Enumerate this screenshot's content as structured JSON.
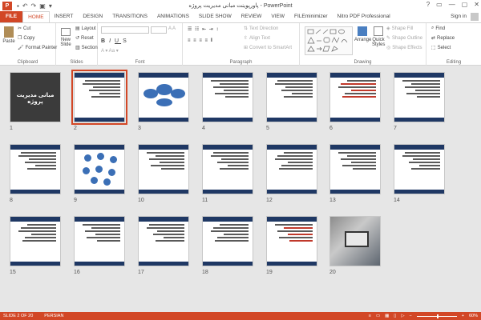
{
  "window": {
    "title": "پاورپوینت مبانی مدیریت پروژه - PowerPoint",
    "app_icon": "P",
    "controls": [
      "?",
      "▭",
      "—",
      "▢",
      "✕"
    ]
  },
  "tabs": [
    "FILE",
    "HOME",
    "INSERT",
    "DESIGN",
    "TRANSITIONS",
    "ANIMATIONS",
    "SLIDE SHOW",
    "REVIEW",
    "VIEW",
    "FILEminimizer",
    "Nitro PDF Professional"
  ],
  "active_tab": "HOME",
  "signin": "Sign in",
  "ribbon": {
    "clipboard": {
      "label": "Clipboard",
      "paste": "Paste",
      "cut": "Cut",
      "copy": "Copy",
      "format_painter": "Format Painter"
    },
    "slides": {
      "label": "Slides",
      "new_slide": "New Slide",
      "layout": "Layout",
      "reset": "Reset",
      "section": "Section"
    },
    "font": {
      "label": "Font"
    },
    "paragraph": {
      "label": "Paragraph",
      "text_direction": "Text Direction",
      "align_text": "Align Text",
      "convert_smartart": "Convert to SmartArt"
    },
    "drawing": {
      "label": "Drawing",
      "arrange": "Arrange",
      "quick_styles": "Quick Styles",
      "shape_fill": "Shape Fill",
      "shape_outline": "Shape Outline",
      "shape_effects": "Shape Effects"
    },
    "editing": {
      "label": "Editing",
      "find": "Find",
      "replace": "Replace",
      "select": "Select"
    }
  },
  "slides": [
    {
      "n": "1",
      "kind": "cover",
      "title": "مبانی مدیریت پروژه"
    },
    {
      "n": "2",
      "kind": "text",
      "selected": true
    },
    {
      "n": "3",
      "kind": "diagram"
    },
    {
      "n": "4",
      "kind": "text"
    },
    {
      "n": "5",
      "kind": "text"
    },
    {
      "n": "6",
      "kind": "text"
    },
    {
      "n": "7",
      "kind": "text"
    },
    {
      "n": "8",
      "kind": "text"
    },
    {
      "n": "9",
      "kind": "bubbles"
    },
    {
      "n": "10",
      "kind": "text"
    },
    {
      "n": "11",
      "kind": "text"
    },
    {
      "n": "12",
      "kind": "text"
    },
    {
      "n": "13",
      "kind": "text"
    },
    {
      "n": "14",
      "kind": "text"
    },
    {
      "n": "15",
      "kind": "text"
    },
    {
      "n": "16",
      "kind": "text"
    },
    {
      "n": "17",
      "kind": "text"
    },
    {
      "n": "18",
      "kind": "text"
    },
    {
      "n": "19",
      "kind": "text"
    },
    {
      "n": "20",
      "kind": "photo"
    }
  ],
  "status": {
    "slide_info": "SLIDE 2 OF 20",
    "language": "PERSIAN",
    "zoom": "60%"
  },
  "colors": {
    "accent": "#d24726",
    "slide_header": "#1f3864"
  }
}
